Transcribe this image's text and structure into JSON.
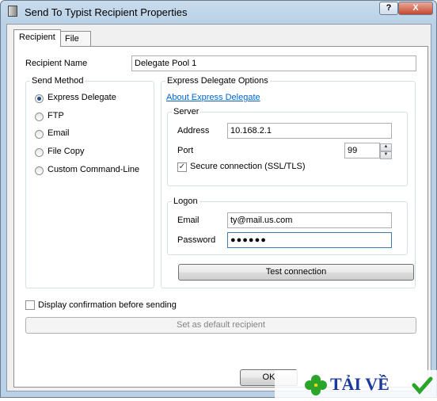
{
  "window": {
    "title": "Send To Typist Recipient Properties",
    "help_label": "?",
    "close_label": "X"
  },
  "tabs": [
    {
      "label": "Recipient"
    },
    {
      "label": "File"
    }
  ],
  "recipient_name": {
    "label": "Recipient Name",
    "value": "Delegate Pool 1"
  },
  "send_method": {
    "title": "Send Method",
    "options": [
      {
        "label": "Express Delegate",
        "selected": true
      },
      {
        "label": "FTP",
        "selected": false
      },
      {
        "label": "Email",
        "selected": false
      },
      {
        "label": "File Copy",
        "selected": false
      },
      {
        "label": "Custom Command-Line",
        "selected": false
      }
    ]
  },
  "express": {
    "title": "Express Delegate Options",
    "about_link": "About Express Delegate",
    "server": {
      "title": "Server",
      "address_label": "Address",
      "address": "10.168.2.1",
      "port_label": "Port",
      "port": "99",
      "ssl_label": "Secure connection (SSL/TLS)",
      "ssl_checked": true
    },
    "logon": {
      "title": "Logon",
      "email_label": "Email",
      "email": "ty@mail.us.com",
      "password_label": "Password",
      "password": "●●●●●●"
    },
    "test_button": "Test connection"
  },
  "confirm_label": "Display confirmation before sending",
  "default_button": "Set as default recipient",
  "ok_button": "OK",
  "watermark": {
    "brand": "TẢI VỀ"
  },
  "colors": {
    "accent_link": "#0066cc",
    "title_bar": "#b9d0e6"
  }
}
